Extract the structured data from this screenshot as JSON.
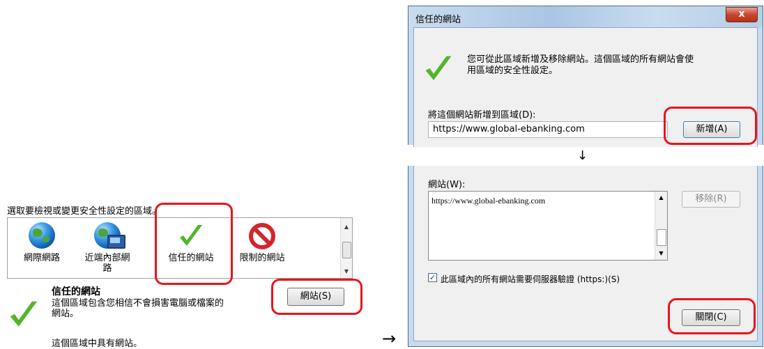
{
  "left_panel": {
    "prompt": "選取要檢視或變更安全性設定的區域。",
    "zones": [
      {
        "label_line1": "網際網路",
        "label_line2": ""
      },
      {
        "label_line1": "近端內部網",
        "label_line2": "路"
      },
      {
        "label_line1": "信任的網站",
        "label_line2": ""
      },
      {
        "label_line1": "限制的網站",
        "label_line2": ""
      }
    ],
    "selected_zone_title": "信任的網站",
    "zone_description_line1": "這個區域包含您相信不會損害電腦或檔案的",
    "zone_description_line2": "網站。",
    "sites_button_label": "網站(S)",
    "zone_status": "這個區域中具有網站。"
  },
  "arrows": {
    "right": "→",
    "down": "↓"
  },
  "dialog": {
    "title": "信任的網站",
    "close_glyph": "x",
    "info_line1": "您可從此區域新增及移除網站。這個區域的所有網站會使",
    "info_line2": "用區域的安全性設定。",
    "add_label": "將這個網站新增到區域(D):",
    "add_input_value": "https://www.global-ebanking.com",
    "add_button": "新增(A)",
    "sites_label": "網站(W):",
    "sites_list": [
      "https://www.global-ebanking.com"
    ],
    "remove_button": "移除(R)",
    "require_https_label": "此區域內的所有網站需要伺服器驗證 (https:)(S)",
    "require_https_checked": true,
    "close_button": "關閉(C)"
  },
  "colors": {
    "highlight": "#e8141c",
    "check_green": "#52b52a",
    "restricted_red": "#d2262c"
  }
}
